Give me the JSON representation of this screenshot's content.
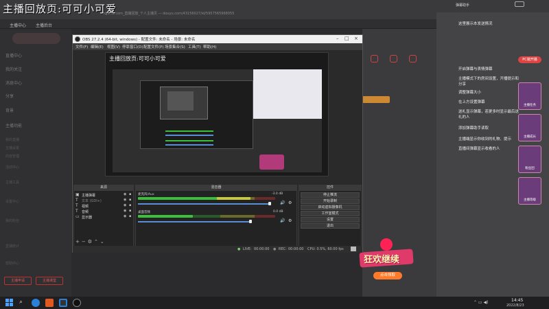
{
  "overlay": {
    "title": "主播回放页:可可小可爱",
    "url": "ngchia.com_直播回放_个人主播页 — douyu.com/43156027/id/5957565968055"
  },
  "browser": {
    "bookmarks": [
      "主播中心",
      "主播后台"
    ]
  },
  "left_sidebar": {
    "items": [
      "直播中心",
      "我的关注",
      "消息中心",
      "分享",
      "背景",
      "主播功能",
      "我的直播",
      "主播设置",
      "内容管理",
      "活动中心",
      "主播工具",
      "设置中心",
      "我的粉丝",
      "直播统计",
      "帮助中心"
    ],
    "buttons": [
      "主播申请",
      "主播课堂"
    ]
  },
  "right_panel": {
    "header": "弹幕助手",
    "top_label": "这里展示本发送情况",
    "menu": [
      "开启弹幕与表情弹幕",
      "主播模式下的房间设置，开播提示和分享",
      "调整弹幕大小",
      "在上方设置弹幕",
      "送礼显示弹幕，若更多时显示最后送礼的人",
      "弹幕",
      "添加弹幕助手读取",
      "主播端显示你收到的礼物、提示",
      "直播间弹幕显示收看的人"
    ],
    "cards": [
      "主播任务",
      "主播成长",
      "粉丝团",
      "主播等级"
    ],
    "pc_badge": "PC端开播",
    "live_badge": "LIVE"
  },
  "promo": {
    "title": "狂欢继续",
    "button": "点击领取"
  },
  "obs": {
    "window_title": "OBS 27.2.4 (64-bit, windows) - 配置文件: 未命名 - 场景: 未命名",
    "menu": [
      "文件(F)",
      "编辑(E)",
      "视图(V)",
      "停靠窗口(D)",
      "配置文件(P)",
      "场景集合(S)",
      "工具(T)",
      "帮助(H)"
    ],
    "preview_caption": "主播回放页:可可小可爱",
    "docks": {
      "sources_title": "来源",
      "mixer_title": "混音器",
      "controls_title": "控件"
    },
    "sources": [
      {
        "icon": "window-capture-icon",
        "label": "主播弹幕"
      },
      {
        "icon": "text-icon",
        "label": "文本 (GDI+)"
      },
      {
        "icon": "text-icon",
        "label": "视频"
      },
      {
        "icon": "text-icon",
        "label": "音频"
      },
      {
        "icon": "display-capture-icon",
        "label": "显示器"
      }
    ],
    "mixer": [
      {
        "label": "麦克风/Aux",
        "db": "-3.0 dB",
        "level": 0.82,
        "volume": 0.96
      },
      {
        "label": "桌面音频",
        "db": "0.0 dB",
        "level": 0.4,
        "volume": 0.82
      }
    ],
    "controls": [
      "停止推流",
      "开始录制",
      "启动虚拟摄像机",
      "工作室模式",
      "设置",
      "退出"
    ],
    "status": {
      "live_label": "LIVE:",
      "live_time": "00:00:00",
      "rec_label": "REC:",
      "rec_time": "00:00:00",
      "cpu": "CPU: 0.5%, 60.00 fps"
    }
  },
  "taskbar": {
    "time": "14:45",
    "date": "2022/8/23"
  },
  "colors": {
    "accent_red": "#cc3333",
    "meter_green": "#3cbf3c",
    "meter_yellow": "#c8c83a",
    "volume_blue": "#5a8fd8"
  }
}
